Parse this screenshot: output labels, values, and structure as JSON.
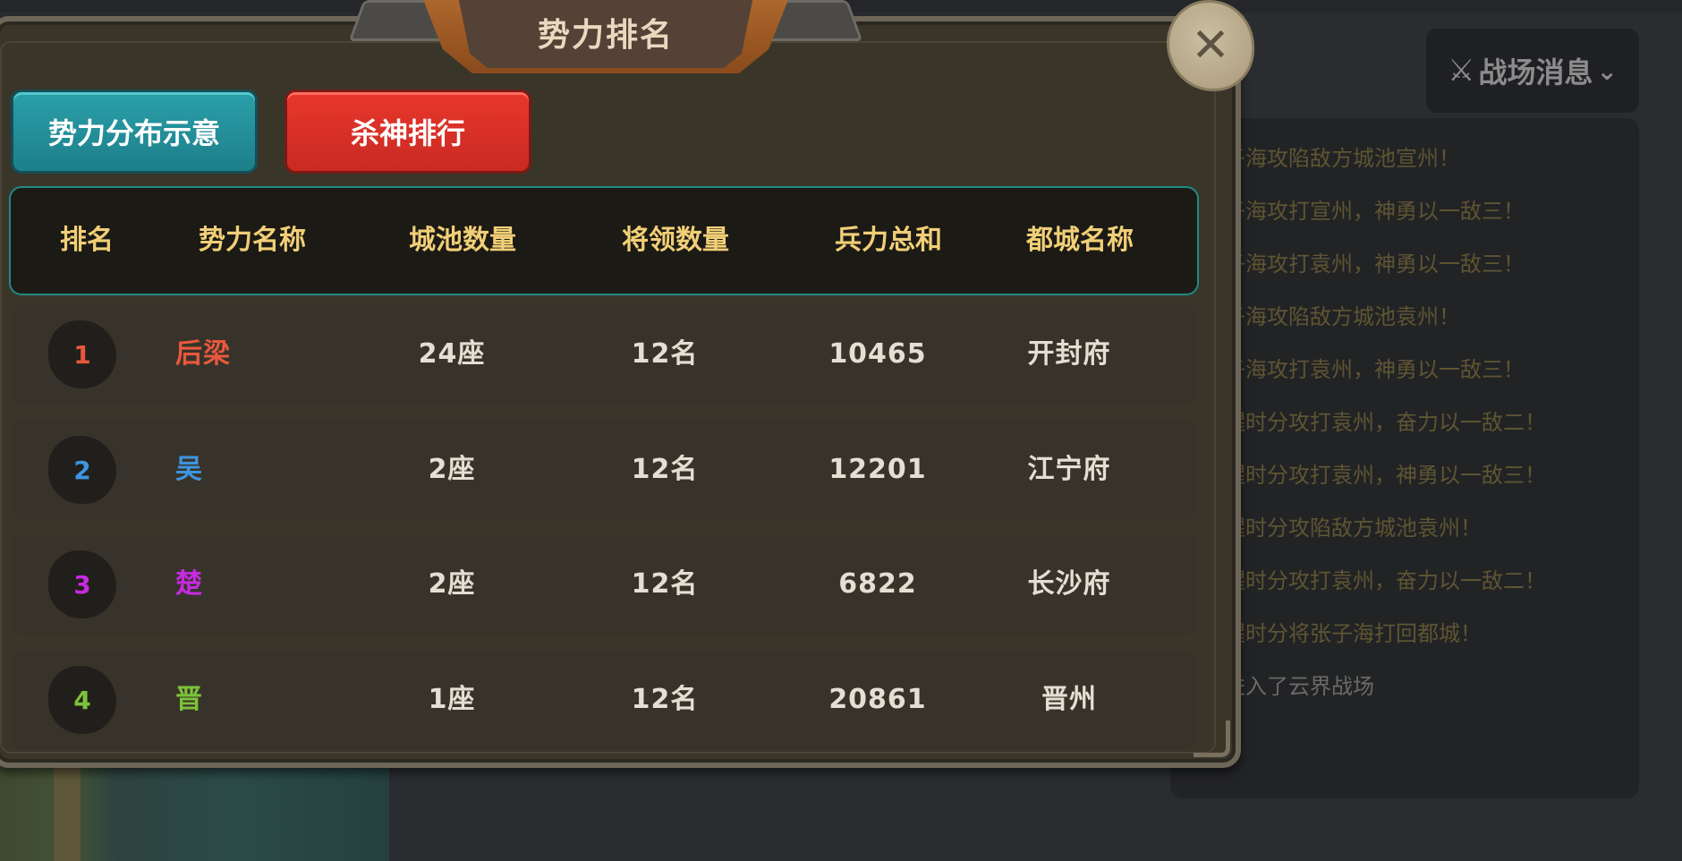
{
  "dialog": {
    "title": "势力排名",
    "close_icon": "close-x-icon",
    "tabs": [
      {
        "label": "势力分布示意",
        "color": "#1f8e99"
      },
      {
        "label": "杀神排行",
        "color": "#e0332a"
      }
    ],
    "columns": [
      "排名",
      "势力名称",
      "城池数量",
      "将领数量",
      "兵力总和",
      "都城名称"
    ],
    "rows": [
      {
        "rank": "1",
        "name": "后梁",
        "color": "#e8583c",
        "cities": "24座",
        "generals": "12名",
        "troops": "10465",
        "capital": "开封府"
      },
      {
        "rank": "2",
        "name": "吴",
        "color": "#3d95e0",
        "cities": "2座",
        "generals": "12名",
        "troops": "12201",
        "capital": "江宁府"
      },
      {
        "rank": "3",
        "name": "楚",
        "color": "#c72ae0",
        "cities": "2座",
        "generals": "12名",
        "troops": "6822",
        "capital": "长沙府"
      },
      {
        "rank": "4",
        "name": "晋",
        "color": "#7cc23a",
        "cities": "1座",
        "generals": "12名",
        "troops": "20861",
        "capital": "晋州"
      }
    ]
  },
  "news": {
    "button_label": "战场消息",
    "button_icon": "crossed-swords-icon",
    "chevron_icon": "chevron-down-icon",
    "items": [
      "子海攻陷敌方城池宣州！",
      "子海攻打宣州，神勇以一敌三！",
      "子海攻打袁州，神勇以一敌三！",
      "子海攻陷敌方城池袁州！",
      "子海攻打袁州，神勇以一敌三！",
      "醒时分攻打袁州，奋力以一敌二！",
      "醒时分攻打袁州，神勇以一敌三！",
      "醒时分攻陷敌方城池袁州！",
      "醒时分攻打袁州，奋力以一敌二！",
      "醒时分将张子海打回都城！",
      "进入了云界战场"
    ]
  }
}
